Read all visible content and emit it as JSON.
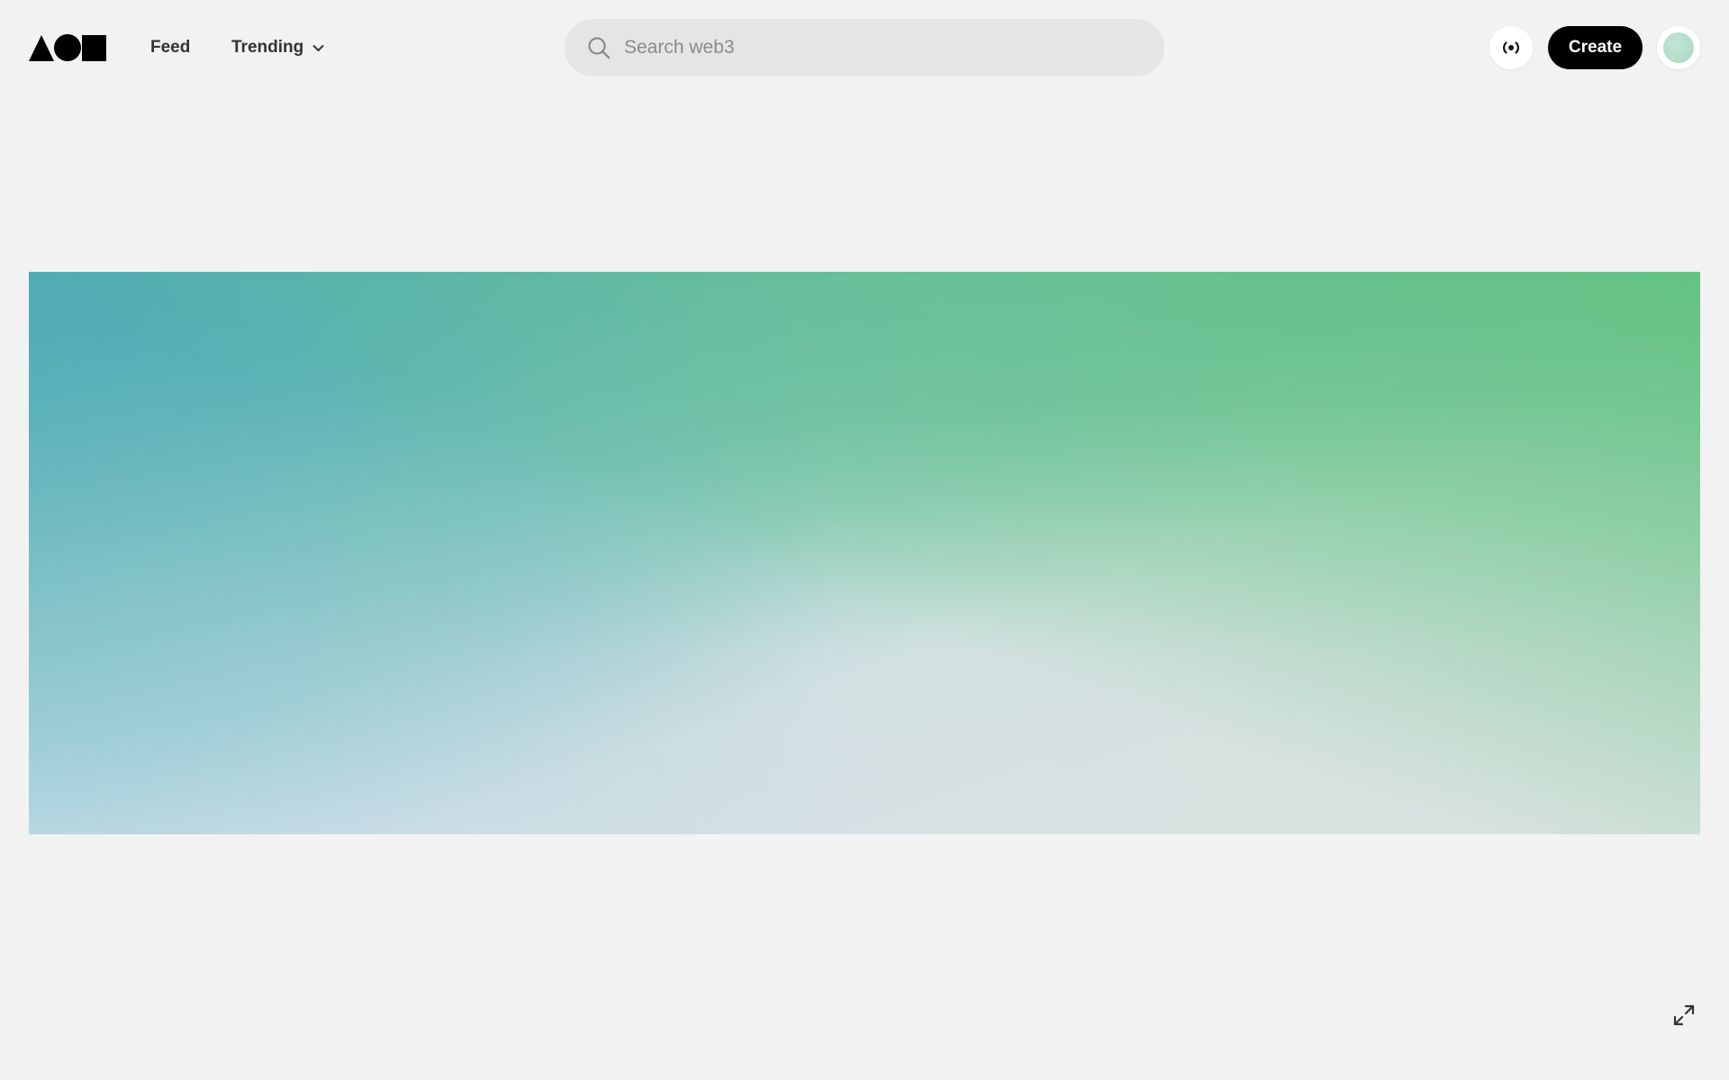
{
  "header": {
    "logo": {
      "icon": "shapes-logo",
      "color": "#000000"
    },
    "nav": {
      "feed_label": "Feed",
      "trending_label": "Trending",
      "trending_icon": "chevron-down-icon"
    },
    "search": {
      "placeholder": "Search web3",
      "value": "",
      "icon": "search-icon"
    },
    "live_button": {
      "icon": "broadcast-icon"
    },
    "create_button": {
      "label": "Create",
      "background": "#000000",
      "text_color": "#ffffff"
    },
    "avatar": {
      "color": "#b5dfc8"
    }
  },
  "banner": {
    "colors": [
      "#4fadb8",
      "#66c38a",
      "#d2e1f1",
      "#dae2df"
    ]
  },
  "expand_button": {
    "icon": "expand-icon"
  },
  "colors": {
    "page_background": "#f2f2f2",
    "search_background": "#e5e5e5",
    "nav_text": "#333333"
  }
}
